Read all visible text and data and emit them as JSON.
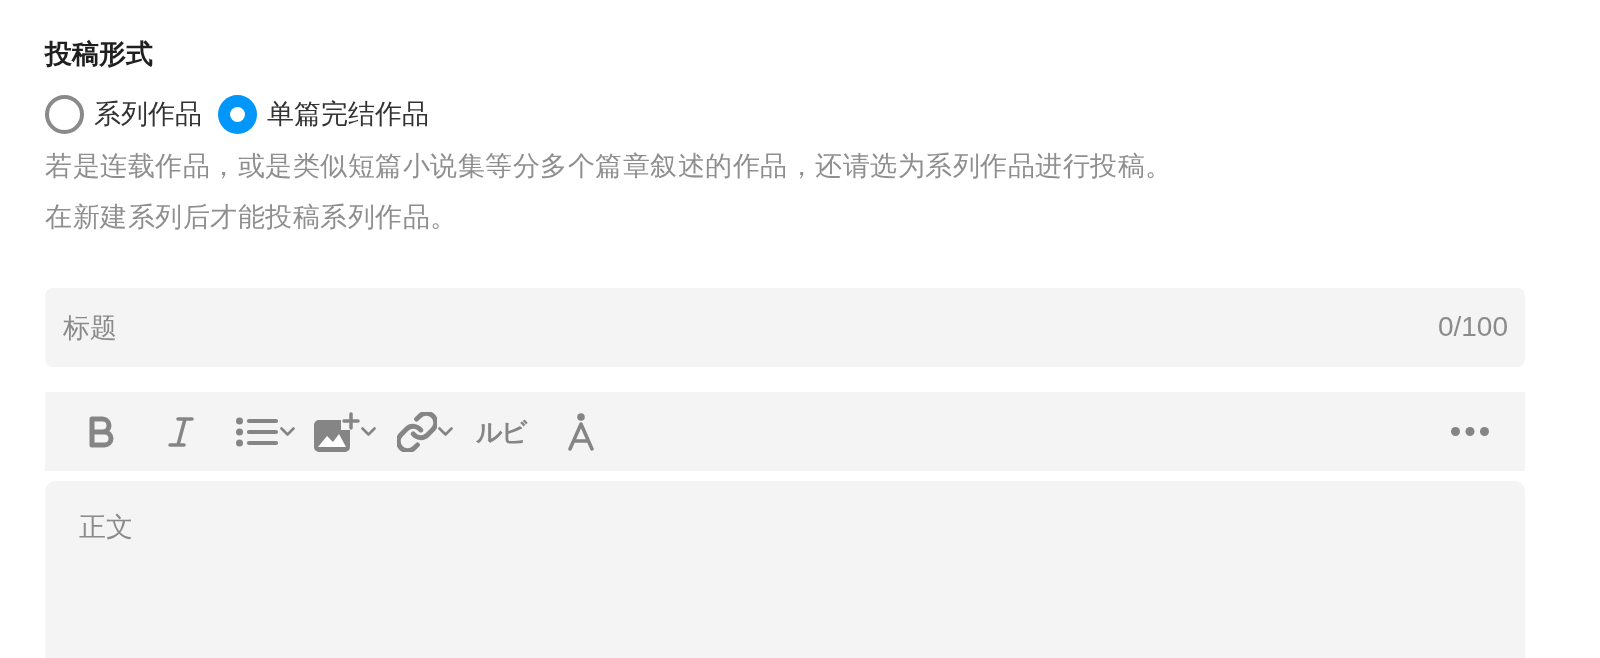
{
  "submission_type": {
    "heading": "投稿形式",
    "options": [
      {
        "label": "系列作品",
        "selected": false
      },
      {
        "label": "单篇完结作品",
        "selected": true
      }
    ],
    "notes": [
      "若是连载作品，或是类似短篇小说集等分多个篇章叙述的作品，还请选为系列作品进行投稿。",
      "在新建系列后才能投稿系列作品。"
    ]
  },
  "title_field": {
    "placeholder": "标题",
    "counter": "0/100"
  },
  "toolbar": {
    "tools": [
      {
        "kind": "bold",
        "has_menu": false
      },
      {
        "kind": "italic",
        "has_menu": false
      },
      {
        "kind": "list",
        "has_menu": true
      },
      {
        "kind": "image",
        "has_menu": true
      },
      {
        "kind": "link",
        "has_menu": true
      },
      {
        "kind": "ruby",
        "label": "ルビ",
        "has_menu": false
      },
      {
        "kind": "emphasis",
        "has_menu": false
      },
      {
        "kind": "more",
        "has_menu": false
      }
    ]
  },
  "body_field": {
    "placeholder": "正文"
  }
}
